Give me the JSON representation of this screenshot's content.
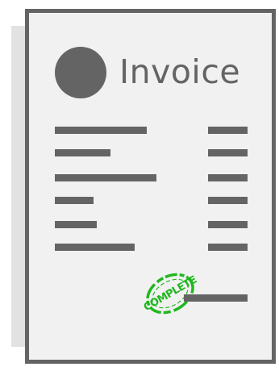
{
  "document": {
    "title": "Invoice",
    "stamp_text": "COMPLETE",
    "line_item_count": 6,
    "has_total_line": true
  },
  "colors": {
    "paper": "#f1f1f1",
    "ink": "#646464",
    "shadow": "#e2e2e2",
    "stamp": "#1fb81f"
  },
  "icons": {
    "logo": "circle-logo-icon",
    "stamp": "complete-stamp-icon"
  }
}
